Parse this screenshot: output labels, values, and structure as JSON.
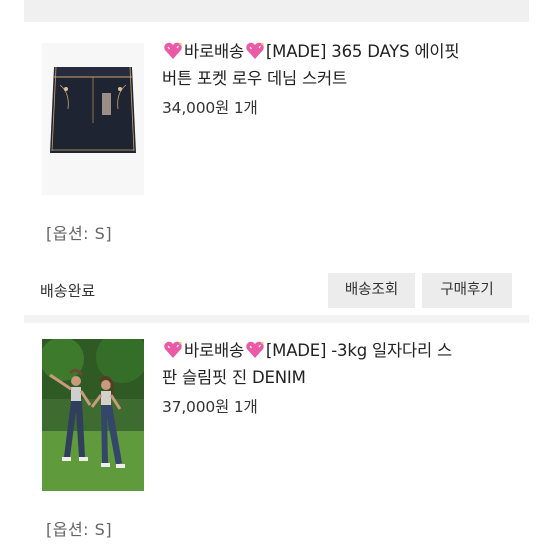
{
  "orders": [
    {
      "title_brand": "바로배송",
      "title_rest_line1": "[MADE] 365 DAYS 에이핏",
      "title_line2": "버튼 포켓 로우 데님 스커트",
      "price": "34,000원",
      "quantity": "1개",
      "option": "[옵션: S]",
      "status": "배송완료",
      "track_label": "배송조회",
      "review_label": "구매후기"
    },
    {
      "title_brand": "바로배송",
      "title_rest_line1": "[MADE] -3kg 일자다리 스",
      "title_line2": "판 슬림핏 진 DENIM",
      "price": "37,000원",
      "quantity": "1개",
      "option": "[옵션: S]"
    }
  ],
  "icons": {
    "title_emoji": "sparkling-heart-icon",
    "heart_color": "#e84a9a"
  }
}
